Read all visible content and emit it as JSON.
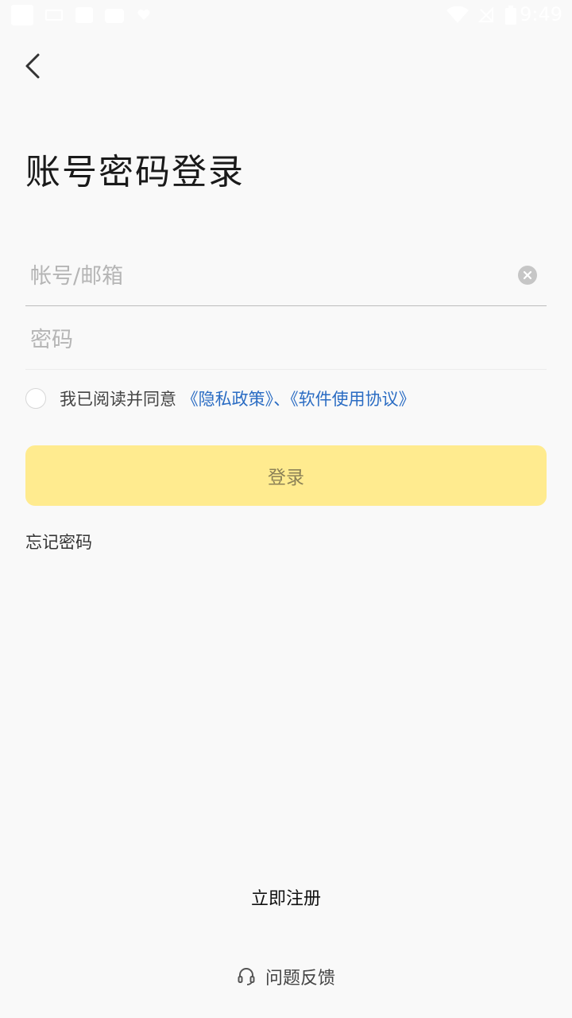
{
  "status_bar": {
    "time": "9:49",
    "icons": [
      "app-icon",
      "notification-icon",
      "image-icon",
      "bag-icon",
      "heart-icon",
      "wifi-icon",
      "no-signal-icon",
      "battery-icon"
    ]
  },
  "header": {
    "back_icon": "chevron-left-icon"
  },
  "page": {
    "title": "账号密码登录"
  },
  "form": {
    "account_placeholder": "帐号/邮箱",
    "account_value": "",
    "password_placeholder": "密码",
    "password_value": "",
    "clear_icon": "close-circle-icon"
  },
  "agreement": {
    "checked": false,
    "prefix": "我已阅读并同意",
    "privacy_link": "《隐私政策》",
    "separator": "、",
    "terms_link": "《软件使用协议》"
  },
  "actions": {
    "login_label": "登录",
    "forgot_label": "忘记密码",
    "register_label": "立即注册",
    "feedback_label": "问题反馈",
    "feedback_icon": "headset-icon"
  },
  "colors": {
    "background": "#f9f9f9",
    "login_button": "#ffeb8f",
    "link": "#2a6cc3",
    "title": "#1a1a1a"
  }
}
